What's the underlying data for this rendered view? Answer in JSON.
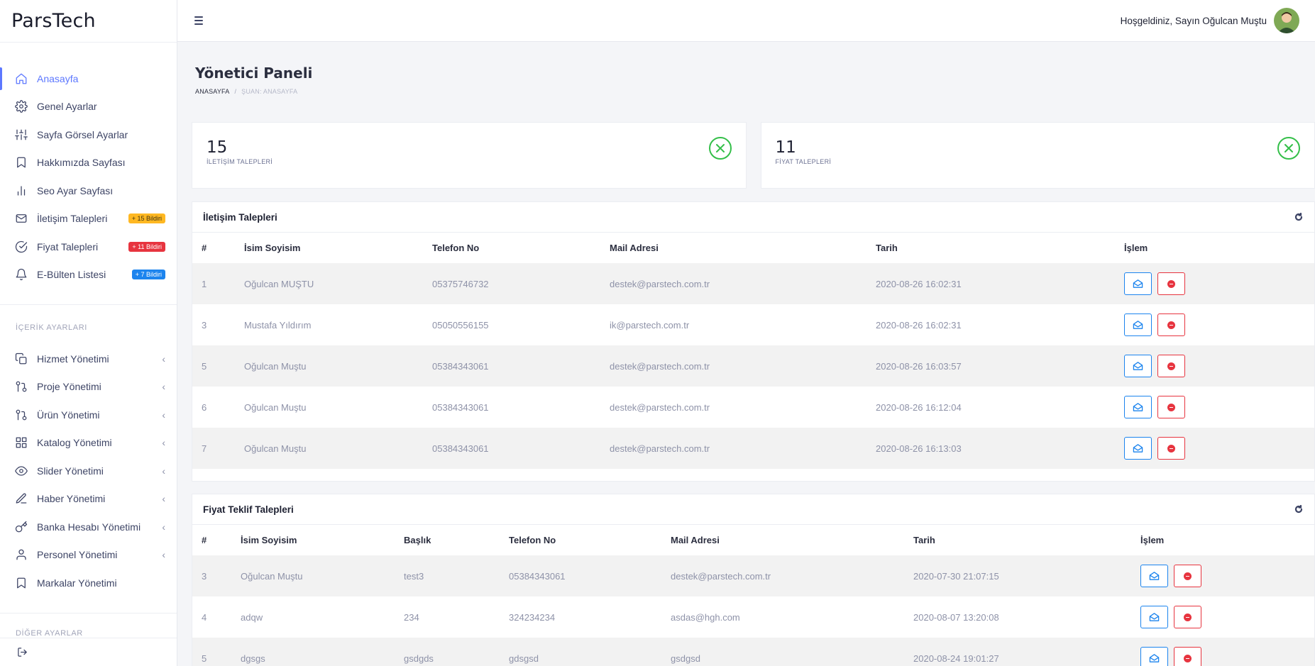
{
  "brand": "ParsTech",
  "topbar": {
    "welcome": "Hoşgeldiniz, Sayın Oğulcan Muştu"
  },
  "sidebar": {
    "items": [
      {
        "label": "Anasayfa",
        "icon": "home-icon",
        "active": true
      },
      {
        "label": "Genel Ayarlar",
        "icon": "gear-icon"
      },
      {
        "label": "Sayfa Görsel Ayarlar",
        "icon": "sliders-icon"
      },
      {
        "label": "Hakkımızda Sayfası",
        "icon": "bookmark-icon"
      },
      {
        "label": "Seo Ayar Sayfası",
        "icon": "bar-chart-icon"
      },
      {
        "label": "İletişim Talepleri",
        "icon": "mail-icon",
        "badge": "+ 15 Bildiri",
        "badge_color": "#ffb822"
      },
      {
        "label": "Fiyat Talepleri",
        "icon": "check-circle-icon",
        "badge": "+ 11 Bildiri",
        "badge_color": "#e7343f"
      },
      {
        "label": "E-Bülten Listesi",
        "icon": "bell-icon",
        "badge": "+ 7 Bildiri",
        "badge_color": "#1c84ee"
      }
    ],
    "section_content": "İÇERİK AYARLARI",
    "content_items": [
      {
        "label": "Hizmet Yönetimi",
        "icon": "copy-icon"
      },
      {
        "label": "Proje Yönetimi",
        "icon": "git-pull-icon"
      },
      {
        "label": "Ürün Yönetimi",
        "icon": "git-pull-icon"
      },
      {
        "label": "Katalog Yönetimi",
        "icon": "grid-icon"
      },
      {
        "label": "Slider Yönetimi",
        "icon": "eye-icon"
      },
      {
        "label": "Haber Yönetimi",
        "icon": "pen-icon"
      },
      {
        "label": "Banka Hesabı Yönetimi",
        "icon": "key-icon"
      },
      {
        "label": "Personel Yönetimi",
        "icon": "user-icon"
      },
      {
        "label": "Markalar Yönetimi",
        "icon": "bookmark-icon"
      }
    ],
    "section_other": "DİĞER AYARLAR"
  },
  "page": {
    "title": "Yönetici Paneli",
    "breadcrumb_home": "ANASAYFA",
    "breadcrumb_sep": "/",
    "breadcrumb_current": "ŞUAN: ANASAYFA"
  },
  "stats": [
    {
      "value": "15",
      "label": "İLETİŞİM TALEPLERİ"
    },
    {
      "value": "11",
      "label": "FİYAT TALEPLERİ"
    }
  ],
  "contact_table": {
    "title": "İletişim Talepleri",
    "headers": [
      "#",
      "İsim Soyisim",
      "Telefon No",
      "Mail Adresi",
      "Tarih",
      "İşlem"
    ],
    "rows": [
      [
        "1",
        "Oğulcan MUŞTU",
        "05375746732",
        "destek@parstech.com.tr",
        "2020-08-26 16:02:31"
      ],
      [
        "3",
        "Mustafa Yıldırım",
        "05050556155",
        "ik@parstech.com.tr",
        "2020-08-26 16:02:31"
      ],
      [
        "5",
        "Oğulcan Muştu",
        "05384343061",
        "destek@parstech.com.tr",
        "2020-08-26 16:03:57"
      ],
      [
        "6",
        "Oğulcan Muştu",
        "05384343061",
        "destek@parstech.com.tr",
        "2020-08-26 16:12:04"
      ],
      [
        "7",
        "Oğulcan Muştu",
        "05384343061",
        "destek@parstech.com.tr",
        "2020-08-26 16:13:03"
      ]
    ]
  },
  "price_table": {
    "title": "Fiyat Teklif Talepleri",
    "headers": [
      "#",
      "İsim Soyisim",
      "Başlık",
      "Telefon No",
      "Mail Adresi",
      "Tarih",
      "İşlem"
    ],
    "rows": [
      [
        "3",
        "Oğulcan Muştu",
        "test3",
        "05384343061",
        "destek@parstech.com.tr",
        "2020-07-30 21:07:15"
      ],
      [
        "4",
        "adqw",
        "234",
        "324234234",
        "asdas@hgh.com",
        "2020-08-07 13:20:08"
      ],
      [
        "5",
        "dgsgs",
        "gsdgds",
        "gdsgsd",
        "gsdgsd",
        "2020-08-24 19:01:27"
      ]
    ]
  }
}
